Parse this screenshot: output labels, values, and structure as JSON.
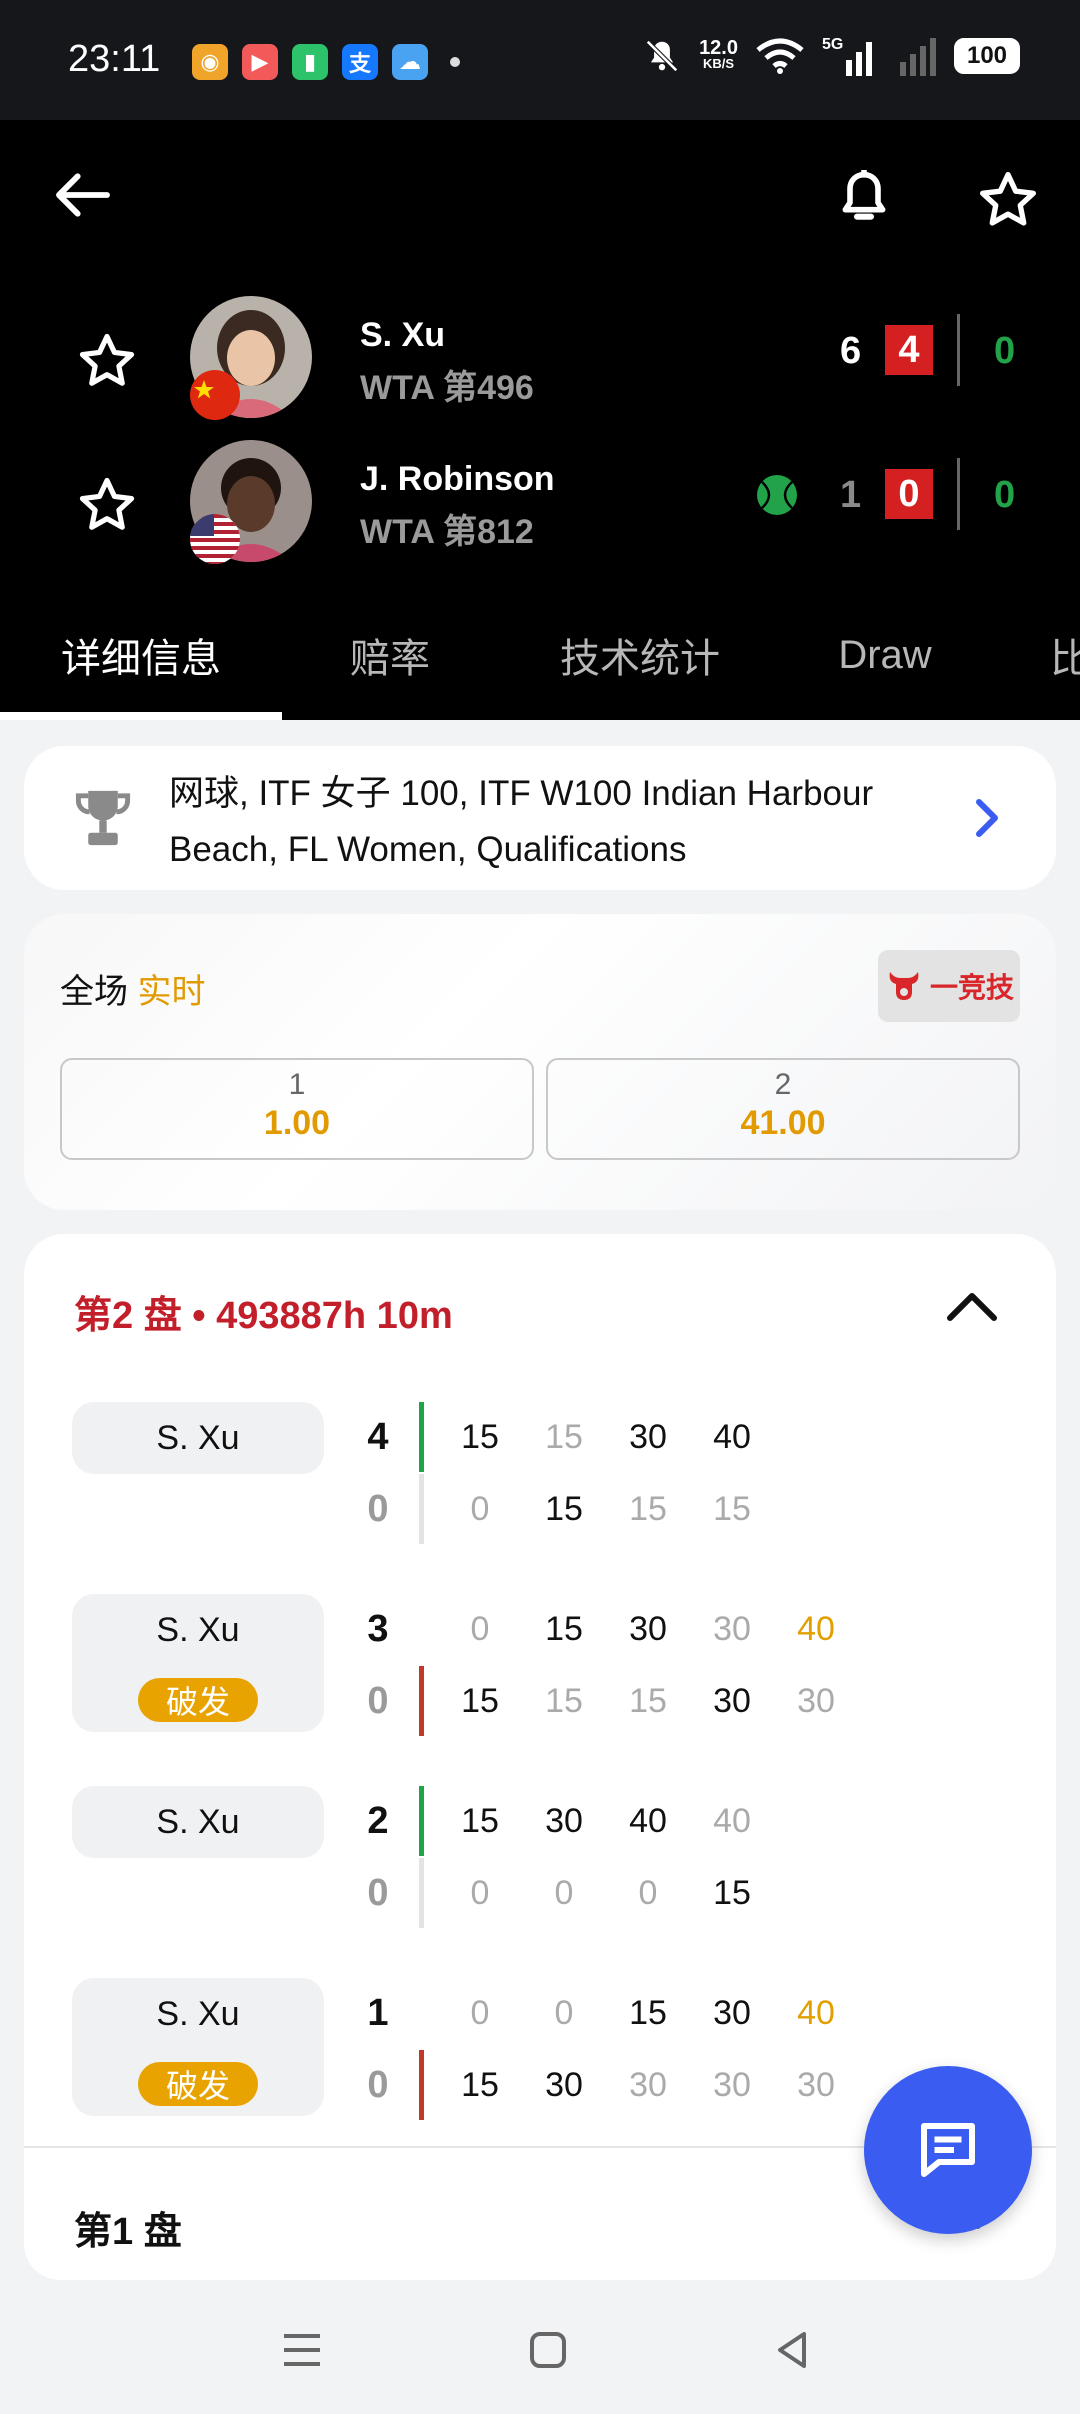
{
  "status_bar": {
    "time": "23:11",
    "app_icons": [
      "weibo-icon",
      "video-icon",
      "battery-saver-icon",
      "alipay-icon",
      "weather-icon"
    ],
    "network_speed_value": "12.0",
    "network_speed_unit": "KB/S",
    "signal_label": "5G",
    "battery": "100"
  },
  "header": {
    "players": [
      {
        "name": "S. Xu",
        "rank": "WTA 第496",
        "flag": "china",
        "set1": "6",
        "set2": "4",
        "points": "0",
        "serving": false
      },
      {
        "name": "J. Robinson",
        "rank": "WTA 第812",
        "flag": "usa",
        "set1": "1",
        "set2": "0",
        "points": "0",
        "serving": true
      }
    ],
    "tabs": [
      "详细信息",
      "赔率",
      "技术统计",
      "Draw",
      "比"
    ]
  },
  "tournament": {
    "text": "网球, ITF 女子 100, ITF W100 Indian Harbour Beach, FL Women, Qualifications"
  },
  "odds": {
    "label_prefix": "全场",
    "label_live": "实时",
    "brand": "一竞技",
    "options": [
      {
        "label": "1",
        "value": "1.00"
      },
      {
        "label": "2",
        "value": "41.00"
      }
    ]
  },
  "set2": {
    "title": "第2 盘 • 493887h 10m",
    "games": [
      {
        "server": "S. Xu",
        "break": false,
        "top_games": "4",
        "bottom_games": "0",
        "bar": "green",
        "top_points": [
          "15",
          "15",
          "30",
          "40"
        ],
        "bottom_points": [
          "0",
          "15",
          "15",
          "15"
        ]
      },
      {
        "server": "S. Xu",
        "break": true,
        "break_label": "破发",
        "top_games": "3",
        "bottom_games": "0",
        "bar": "red",
        "top_points": [
          "0",
          "15",
          "30",
          "30",
          "40"
        ],
        "bottom_points": [
          "15",
          "15",
          "15",
          "30",
          "30"
        ]
      },
      {
        "server": "S. Xu",
        "break": false,
        "top_games": "2",
        "bottom_games": "0",
        "bar": "green",
        "top_points": [
          "15",
          "30",
          "40",
          "40"
        ],
        "bottom_points": [
          "0",
          "0",
          "0",
          "15"
        ]
      },
      {
        "server": "S. Xu",
        "break": true,
        "break_label": "破发",
        "top_games": "1",
        "bottom_games": "0",
        "bar": "red",
        "top_points": [
          "0",
          "0",
          "15",
          "30",
          "40"
        ],
        "bottom_points": [
          "15",
          "30",
          "30",
          "30",
          "30"
        ]
      }
    ]
  },
  "set1": {
    "title": "第1 盘"
  },
  "colors": {
    "accent_red": "#c21f2b",
    "accent_orange": "#e1a000",
    "accent_green": "#22a34a",
    "fab_blue": "#3a5cf0"
  }
}
